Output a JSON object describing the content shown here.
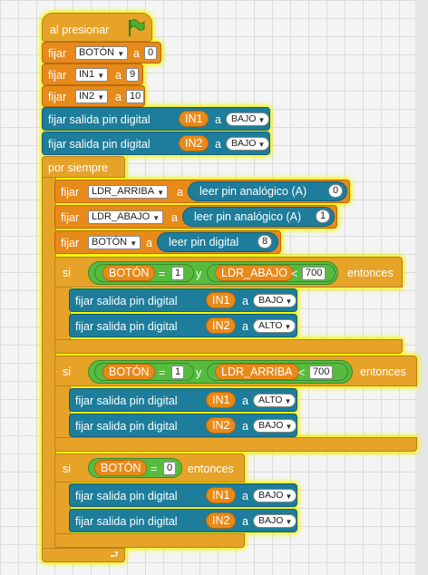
{
  "hat": {
    "label": "al presionar",
    "flag_icon": "green-flag-icon"
  },
  "init_blocks": [
    {
      "set": "fijar",
      "var": "BOTÓN",
      "a": "a",
      "value": "0"
    },
    {
      "set": "fijar",
      "var": "IN1",
      "a": "a",
      "value": "9"
    },
    {
      "set": "fijar",
      "var": "IN2",
      "a": "a",
      "value": "10"
    }
  ],
  "digital_out_top": [
    {
      "label": "fijar salida pin digital",
      "pin": "IN1",
      "a": "a",
      "value": "BAJO"
    },
    {
      "label": "fijar salida pin digital",
      "pin": "IN2",
      "a": "a",
      "value": "BAJO"
    }
  ],
  "loop": {
    "label": "por siempre"
  },
  "loop_sets": [
    {
      "set": "fijar",
      "var": "LDR_ARRIBA",
      "a": "a",
      "reader": "leer pin analógico (A)",
      "pin": "0"
    },
    {
      "set": "fijar",
      "var": "LDR_ABAJO",
      "a": "a",
      "reader": "leer pin analógico (A)",
      "pin": "1"
    },
    {
      "set": "fijar",
      "var": "BOTÓN",
      "a": "a",
      "reader": "leer pin digital",
      "pin": "8"
    }
  ],
  "if1": {
    "si": "si",
    "var1": "BOTÓN",
    "op1": "=",
    "val1": "1",
    "and": "y",
    "var2": "LDR_ABAJO",
    "op2": "<",
    "val2": "700",
    "then": "entonces",
    "body": [
      {
        "label": "fijar salida pin digital",
        "pin": "IN1",
        "a": "a",
        "value": "BAJO"
      },
      {
        "label": "fijar salida pin digital",
        "pin": "IN2",
        "a": "a",
        "value": "ALTO"
      }
    ]
  },
  "if2": {
    "si": "si",
    "var1": "BOTÓN",
    "op1": "=",
    "val1": "1",
    "and": "y",
    "var2": "LDR_ARRIBA",
    "op2": "<",
    "val2": "700",
    "then": "entonces",
    "body": [
      {
        "label": "fijar salida pin digital",
        "pin": "IN1",
        "a": "a",
        "value": "ALTO"
      },
      {
        "label": "fijar salida pin digital",
        "pin": "IN2",
        "a": "a",
        "value": "BAJO"
      }
    ]
  },
  "if3": {
    "si": "si",
    "var1": "BOTÓN",
    "op1": "=",
    "val1": "0",
    "then": "entonces",
    "body": [
      {
        "label": "fijar salida pin digital",
        "pin": "IN1",
        "a": "a",
        "value": "BAJO"
      },
      {
        "label": "fijar salida pin digital",
        "pin": "IN2",
        "a": "a",
        "value": "BAJO"
      }
    ]
  },
  "loop_end_icon": "loop-arrow-icon",
  "colors": {
    "control": "#e6a328",
    "variables": "#e88a1a",
    "pins": "#1d7d9b",
    "operators": "#57bb3f",
    "highlight": "#f4f400"
  }
}
